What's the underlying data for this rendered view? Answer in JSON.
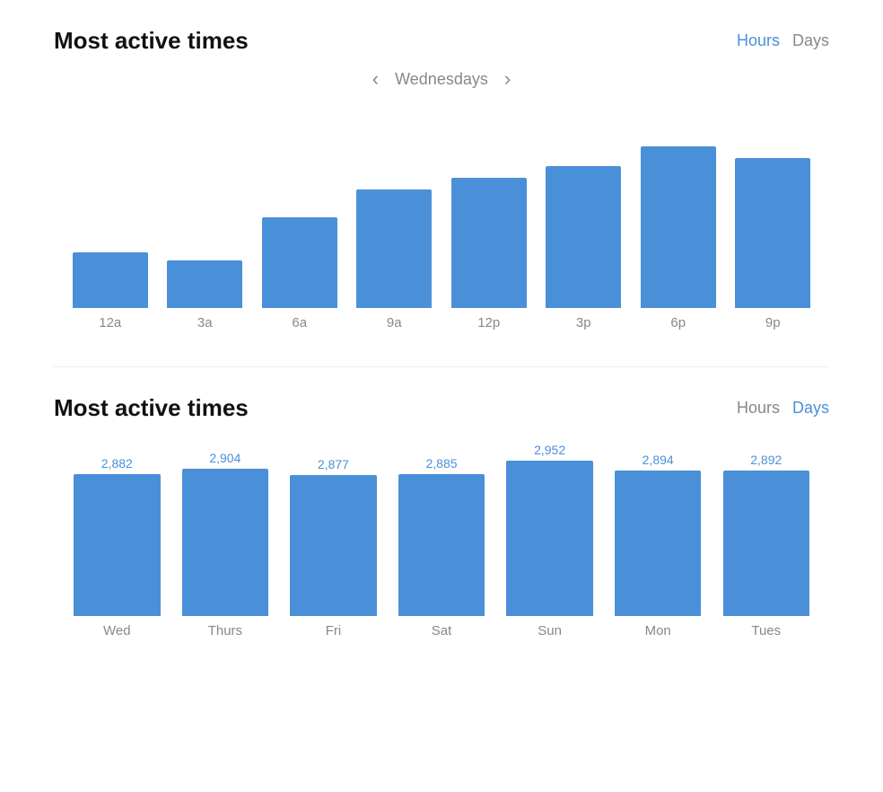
{
  "section1": {
    "title": "Most active times",
    "toggleHours": "Hours",
    "toggleDays": "Days",
    "activeToggle": "hours",
    "nav": {
      "prevArrow": "‹",
      "nextArrow": "›",
      "currentDay": "Wednesdays"
    },
    "bars": [
      {
        "label": "12a",
        "heightPct": 28
      },
      {
        "label": "3a",
        "heightPct": 24
      },
      {
        "label": "6a",
        "heightPct": 46
      },
      {
        "label": "9a",
        "heightPct": 60
      },
      {
        "label": "12p",
        "heightPct": 66
      },
      {
        "label": "3p",
        "heightPct": 72
      },
      {
        "label": "6p",
        "heightPct": 82
      },
      {
        "label": "9p",
        "heightPct": 76
      }
    ]
  },
  "section2": {
    "title": "Most active times",
    "toggleHours": "Hours",
    "toggleDays": "Days",
    "activeToggle": "days",
    "bars": [
      {
        "label": "Wed",
        "value": "2,882",
        "heightPct": 88
      },
      {
        "label": "Thurs",
        "value": "2,904",
        "heightPct": 91
      },
      {
        "label": "Fri",
        "value": "2,877",
        "heightPct": 87
      },
      {
        "label": "Sat",
        "value": "2,885",
        "heightPct": 88
      },
      {
        "label": "Sun",
        "value": "2,952",
        "heightPct": 96
      },
      {
        "label": "Mon",
        "value": "2,894",
        "heightPct": 90
      },
      {
        "label": "Tues",
        "value": "2,892",
        "heightPct": 90
      }
    ]
  },
  "colors": {
    "barBlue": "#4a90d9",
    "activeToggle": "#4a90d9",
    "inactiveToggle": "#999"
  }
}
